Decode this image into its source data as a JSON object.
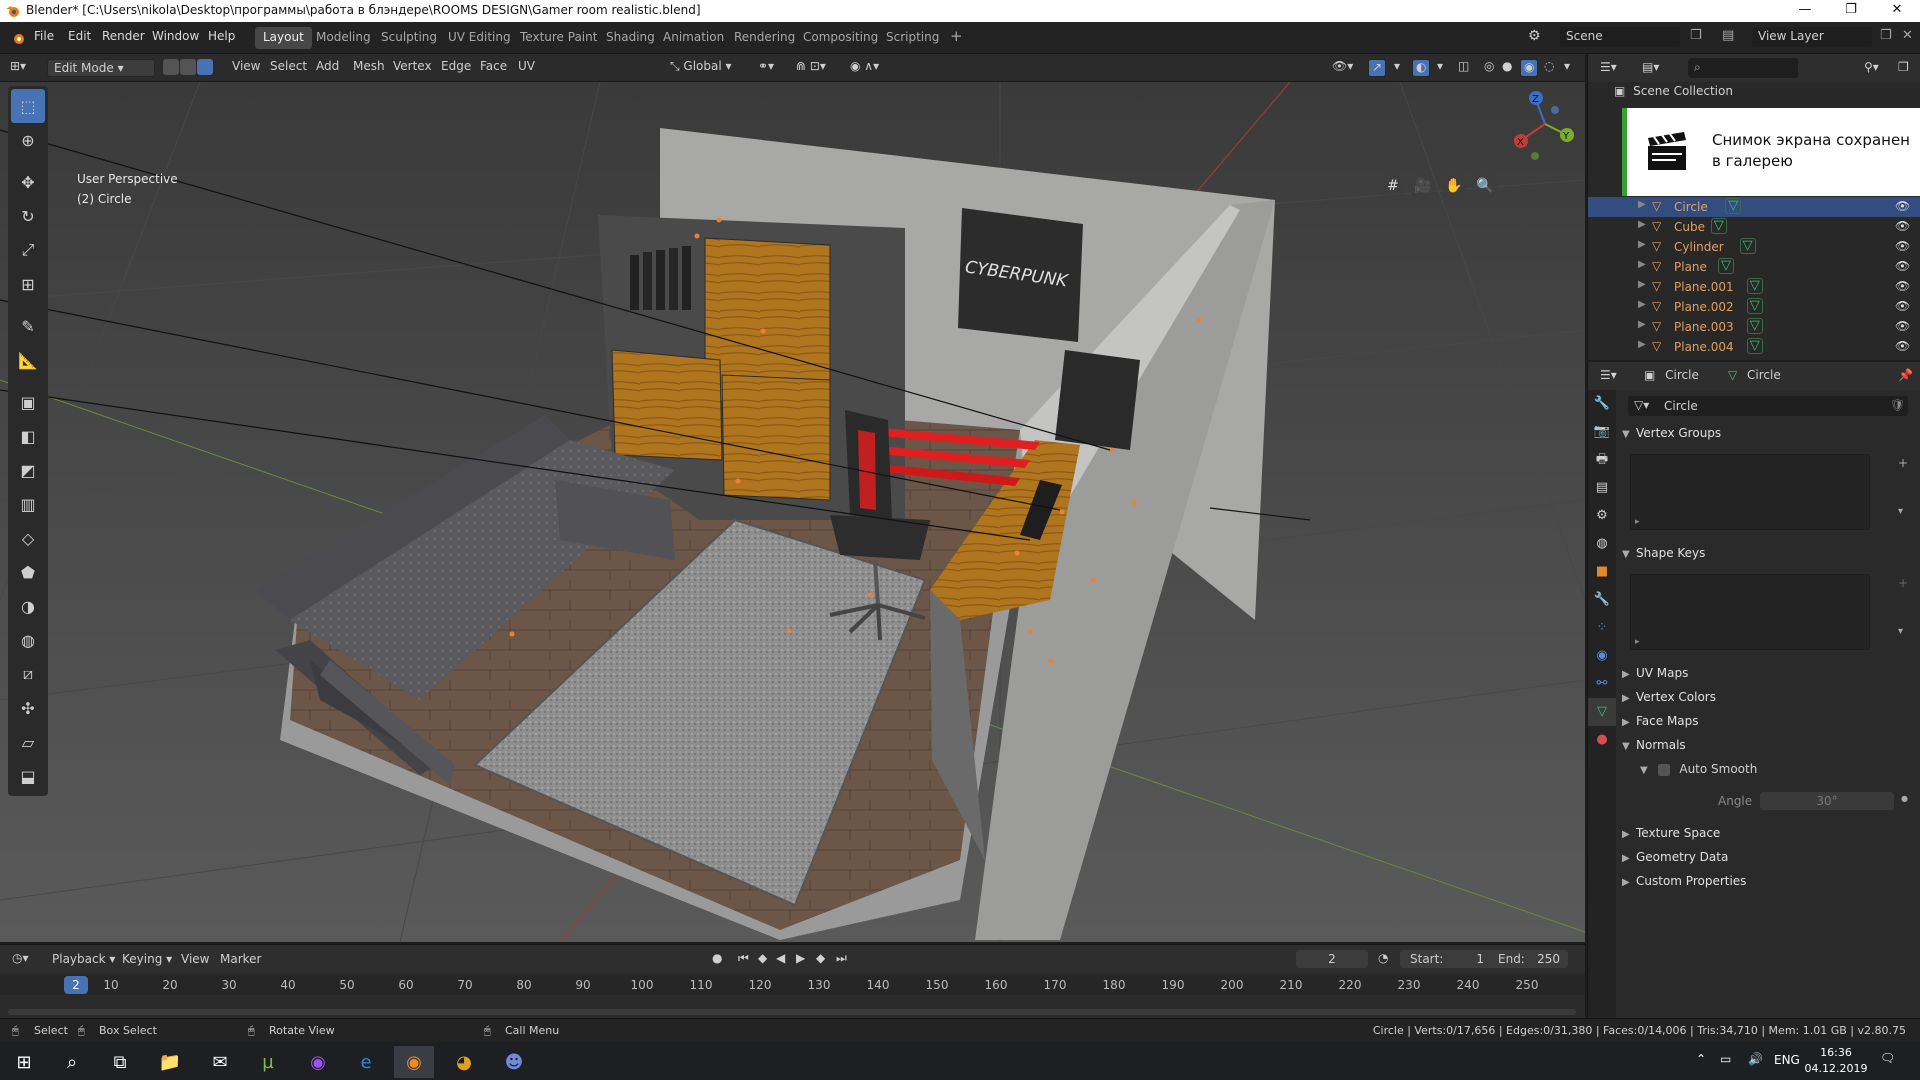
{
  "window": {
    "title": "Blender* [C:\\Users\\nikola\\Desktop\\программы\\работа в блэндере\\ROOMS DESIGN\\Gamer room realistic.blend]"
  },
  "menu": [
    "File",
    "Edit",
    "Render",
    "Window",
    "Help"
  ],
  "workspaces": [
    "Layout",
    "Modeling",
    "Sculpting",
    "UV Editing",
    "Texture Paint",
    "Shading",
    "Animation",
    "Rendering",
    "Compositing",
    "Scripting"
  ],
  "active_workspace": "Layout",
  "scene_name": "Scene",
  "view_layer": "View Layer",
  "header": {
    "mode": "Edit Mode",
    "menus": [
      "View",
      "Select",
      "Add",
      "Mesh",
      "Vertex",
      "Edge",
      "Face",
      "UV"
    ],
    "orientation": "Global"
  },
  "viewport": {
    "line1": "User Perspective",
    "line2": "(2) Circle",
    "poster_text": "CYBERPUNK",
    "gizmo": {
      "x": "X",
      "y": "Y",
      "z": "Z"
    }
  },
  "outliner": {
    "collection": "Scene Collection",
    "items": [
      {
        "name": "Circle",
        "selected": true
      },
      {
        "name": "Cube",
        "selected": false
      },
      {
        "name": "Cylinder",
        "selected": false
      },
      {
        "name": "Plane",
        "selected": false
      },
      {
        "name": "Plane.001",
        "selected": false
      },
      {
        "name": "Plane.002",
        "selected": false
      },
      {
        "name": "Plane.003",
        "selected": false
      },
      {
        "name": "Plane.004",
        "selected": false
      }
    ]
  },
  "notification": {
    "text": "Снимок экрана сохранен в галерею"
  },
  "properties": {
    "crumb_object": "Circle",
    "crumb_data": "Circle",
    "mesh_name": "Circle",
    "panels": {
      "vertex_groups": "Vertex Groups",
      "shape_keys": "Shape Keys",
      "uv_maps": "UV Maps",
      "vertex_colors": "Vertex Colors",
      "face_maps": "Face Maps",
      "normals": "Normals",
      "auto_smooth": "Auto Smooth",
      "angle_label": "Angle",
      "angle_value": "30°",
      "texture_space": "Texture Space",
      "geometry_data": "Geometry Data",
      "custom_properties": "Custom Properties"
    }
  },
  "timeline": {
    "menus": [
      "Playback",
      "Keying",
      "View",
      "Marker"
    ],
    "current_frame": "2",
    "start_label": "Start:",
    "start": "1",
    "end_label": "End:",
    "end": "250",
    "ticks": [
      "10",
      "20",
      "30",
      "40",
      "50",
      "60",
      "70",
      "80",
      "90",
      "100",
      "110",
      "120",
      "130",
      "140",
      "150",
      "160",
      "170",
      "180",
      "190",
      "200",
      "210",
      "220",
      "230",
      "240",
      "250"
    ]
  },
  "status": {
    "select": "Select",
    "box_select": "Box Select",
    "rotate": "Rotate View",
    "call_menu": "Call Menu",
    "stats": "Circle | Verts:0/17,656 | Edges:0/31,380 | Faces:0/14,006 | Tris:34,710 | Mem: 1.01 GB | v2.80.75"
  },
  "taskbar": {
    "lang": "ENG",
    "time": "16:36",
    "date": "04.12.2019"
  },
  "colors": {
    "accent": "#4772b3",
    "selected_row": "#334d80",
    "object_orange": "#e0a060",
    "mesh_green": "#3dbf7d",
    "playhead": "#4772b3"
  }
}
